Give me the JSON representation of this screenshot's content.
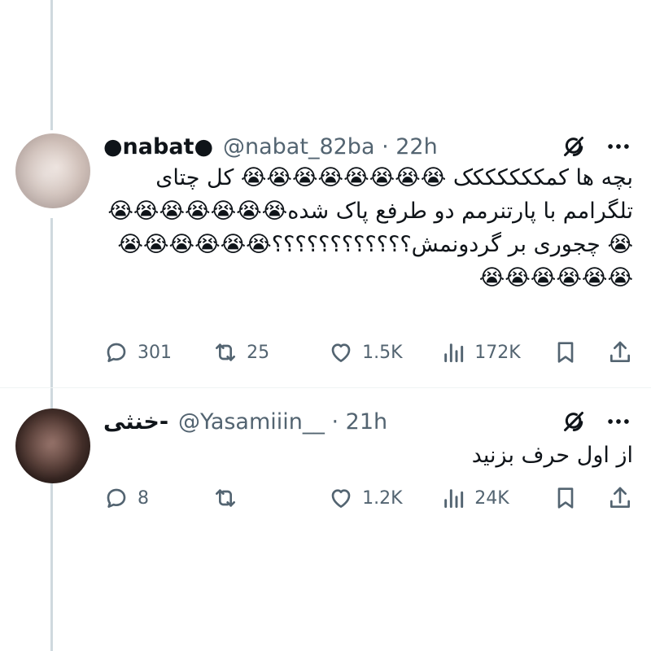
{
  "tweets": [
    {
      "name": "●nabat●",
      "handle": "@nabat_82ba · 22h",
      "text": "بچه ها کمککککککک 😭😭😭😭😭😭😭😭 کل چتای تلگرامم با پارتنرمم دو طرفع پاک شده😭😭😭😭😭😭😭😭 چجوری بر گردونمش؟؟؟؟؟؟؟؟؟؟؟؟😭😭😭😭😭😭😭😭😭😭😭😭",
      "replies": "301",
      "reposts": "25",
      "likes": "1.5K",
      "views": "172K"
    },
    {
      "name": "خنثی-",
      "handle": "@Yasamiiin__ · 21h",
      "text": "از اول حرف بزنید",
      "replies": "8",
      "reposts": "",
      "likes": "1.2K",
      "views": "24K"
    }
  ],
  "icons": {
    "reply": "reply-icon",
    "repost": "repost-icon",
    "like": "like-icon",
    "views": "views-icon",
    "bookmark": "bookmark-icon",
    "share": "share-icon",
    "grok": "grok-icon",
    "more": "more-icon"
  },
  "colors": {
    "text": "#0f1419",
    "muted": "#536471",
    "thread_line": "#cfd9de"
  }
}
